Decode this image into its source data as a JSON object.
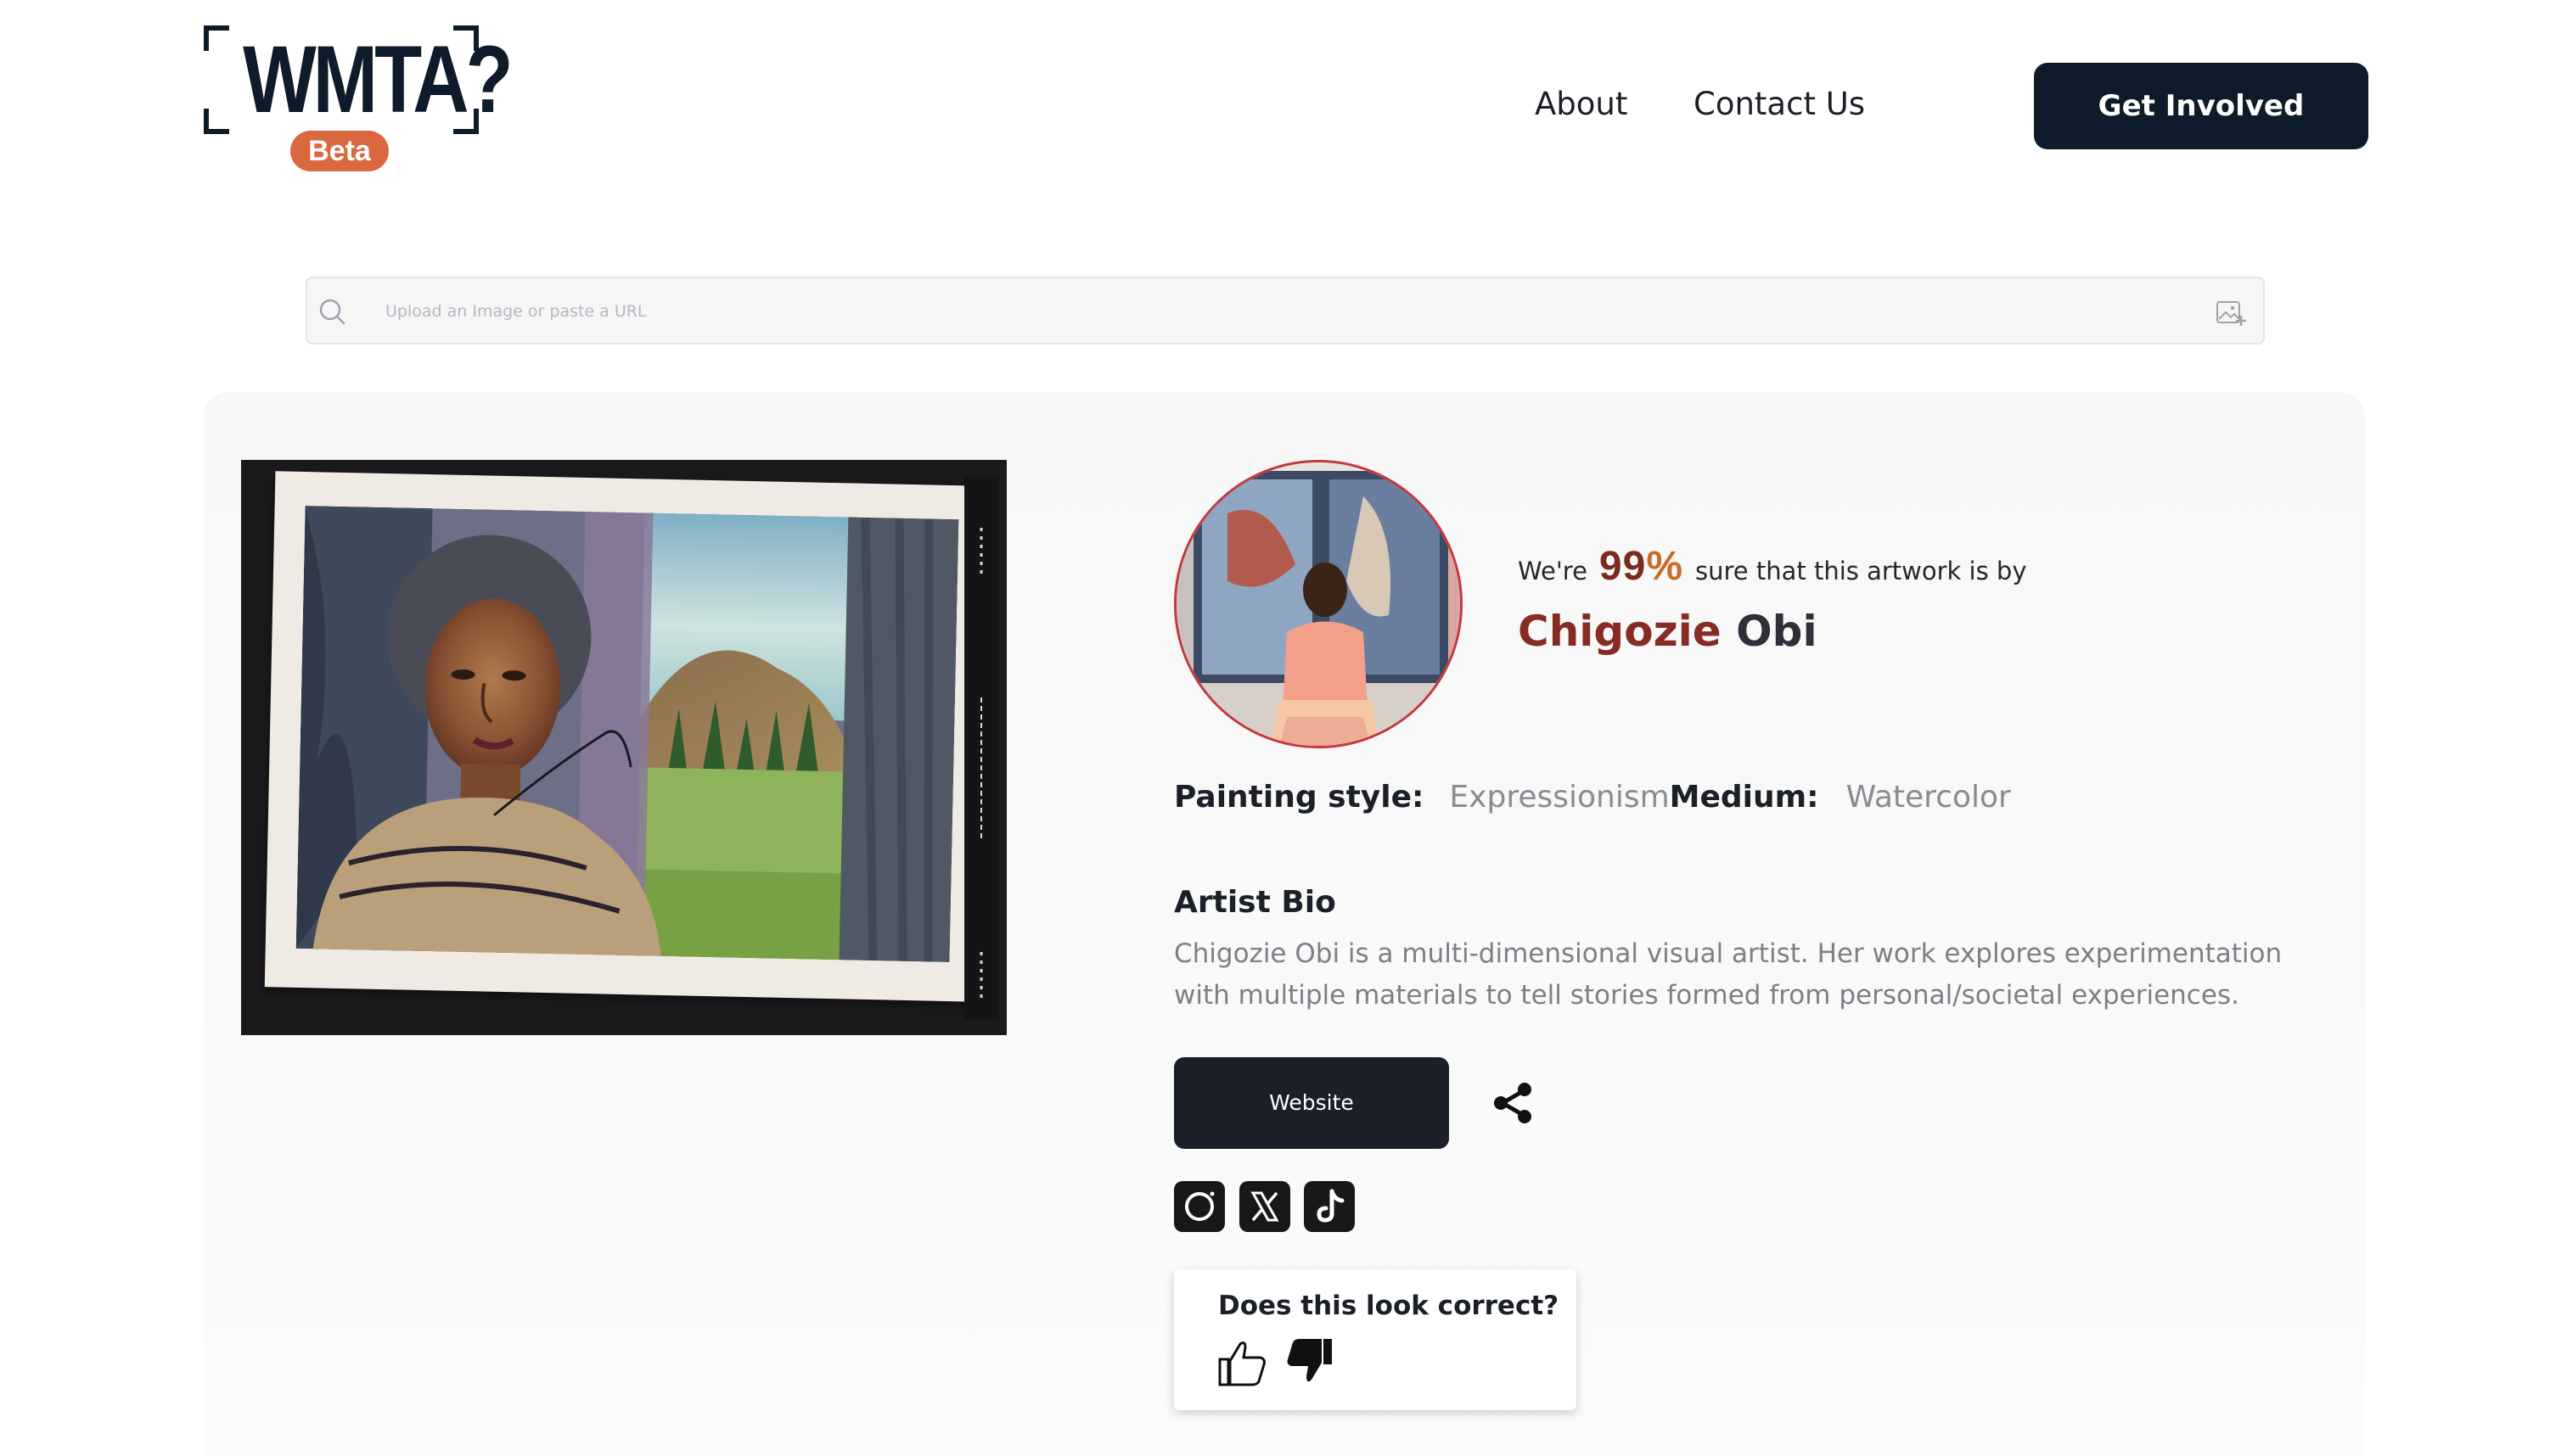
{
  "header": {
    "logo_text": "WMTA?",
    "beta_badge": "Beta",
    "nav": [
      {
        "label": "About"
      },
      {
        "label": "Contact Us"
      }
    ],
    "cta_label": "Get Involved"
  },
  "search": {
    "placeholder": "Upload an Image or paste a URL",
    "value": "",
    "left_icon": "search-icon",
    "right_icon": "image-upload-icon"
  },
  "result": {
    "confidence_prefix": "We're",
    "confidence_number": "99",
    "confidence_symbol": "%",
    "confidence_suffix": "sure that this artwork is by",
    "artist_first_name": "Chigozie",
    "artist_last_name": "Obi",
    "painting_style_label": "Painting style:",
    "painting_style_value": "Expressionism",
    "medium_label": "Medium:",
    "medium_value": "Watercolor",
    "bio_title": "Artist Bio",
    "bio_text": "Chigozie Obi is a multi-dimensional visual artist. Her work explores experimentation with multiple materials to tell stories formed from personal/societal experiences.",
    "website_label": "Website",
    "share_icon": "share-icon",
    "social_icons": [
      "instagram-icon",
      "x-icon",
      "tiktok-icon"
    ]
  },
  "feedback": {
    "question": "Does this look correct?",
    "icons": [
      "thumbs-up-icon",
      "thumbs-down-icon"
    ]
  },
  "colors": {
    "navy": "#0d1b2a",
    "beta_orange": "#d9683f",
    "artist_red": "#862c24",
    "percent_orange": "#c86d2c",
    "avatar_ring": "#c4383c",
    "muted_text": "#7e7e87",
    "button_dark": "#1b1f27"
  }
}
